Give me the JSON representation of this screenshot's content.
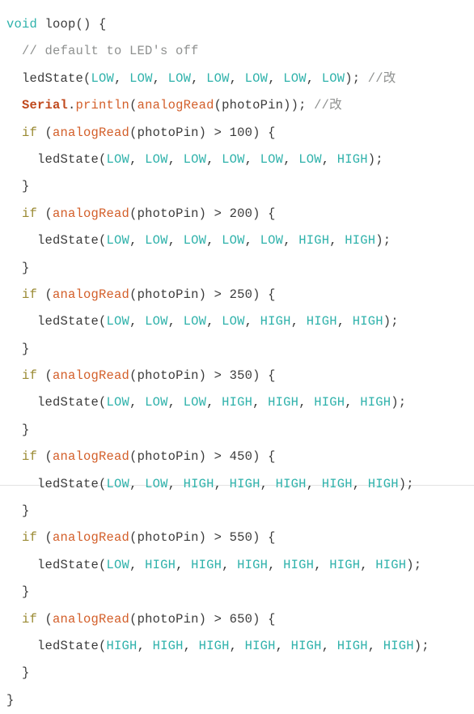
{
  "code_block": {
    "language": "arduino",
    "background_color": "#ffffff",
    "colors": {
      "keyword": "#2fb2ab",
      "constant": "#2fb2ab",
      "control": "#9a8a33",
      "function": "#d35f2a",
      "object": "#c0491d",
      "comment": "#8f9190",
      "plain": "#3b3b3b",
      "border": "#e3e3e3"
    },
    "lines": [
      {
        "indent": 0,
        "tokens": [
          {
            "text": "void",
            "type": "keyword"
          },
          {
            "text": " ",
            "type": "plain"
          },
          {
            "text": "loop",
            "type": "plain"
          },
          {
            "text": "() {",
            "type": "punct"
          }
        ]
      },
      {
        "indent": 1,
        "tokens": [
          {
            "text": "// default to LED's off",
            "type": "comment"
          }
        ]
      },
      {
        "indent": 1,
        "tokens": [
          {
            "text": "ledState",
            "type": "plain"
          },
          {
            "text": "(",
            "type": "punct"
          },
          {
            "text": "LOW",
            "type": "constant"
          },
          {
            "text": ", ",
            "type": "punct"
          },
          {
            "text": "LOW",
            "type": "constant"
          },
          {
            "text": ", ",
            "type": "punct"
          },
          {
            "text": "LOW",
            "type": "constant"
          },
          {
            "text": ", ",
            "type": "punct"
          },
          {
            "text": "LOW",
            "type": "constant"
          },
          {
            "text": ", ",
            "type": "punct"
          },
          {
            "text": "LOW",
            "type": "constant"
          },
          {
            "text": ", ",
            "type": "punct"
          },
          {
            "text": "LOW",
            "type": "constant"
          },
          {
            "text": ", ",
            "type": "punct"
          },
          {
            "text": "LOW",
            "type": "constant"
          },
          {
            "text": "); ",
            "type": "punct"
          },
          {
            "text": "//改",
            "type": "comment"
          }
        ]
      },
      {
        "indent": 1,
        "tokens": [
          {
            "text": "Serial",
            "type": "object"
          },
          {
            "text": ".",
            "type": "punct"
          },
          {
            "text": "println",
            "type": "function"
          },
          {
            "text": "(",
            "type": "punct"
          },
          {
            "text": "analogRead",
            "type": "function"
          },
          {
            "text": "(photoPin)); ",
            "type": "punct"
          },
          {
            "text": "//改",
            "type": "comment"
          }
        ]
      },
      {
        "indent": 1,
        "tokens": [
          {
            "text": "if",
            "type": "control"
          },
          {
            "text": " (",
            "type": "punct"
          },
          {
            "text": "analogRead",
            "type": "function"
          },
          {
            "text": "(photoPin) > ",
            "type": "punct"
          },
          {
            "text": "100",
            "type": "number"
          },
          {
            "text": ") {",
            "type": "punct"
          }
        ]
      },
      {
        "indent": 2,
        "tokens": [
          {
            "text": "ledState",
            "type": "plain"
          },
          {
            "text": "(",
            "type": "punct"
          },
          {
            "text": "LOW",
            "type": "constant"
          },
          {
            "text": ", ",
            "type": "punct"
          },
          {
            "text": "LOW",
            "type": "constant"
          },
          {
            "text": ", ",
            "type": "punct"
          },
          {
            "text": "LOW",
            "type": "constant"
          },
          {
            "text": ", ",
            "type": "punct"
          },
          {
            "text": "LOW",
            "type": "constant"
          },
          {
            "text": ", ",
            "type": "punct"
          },
          {
            "text": "LOW",
            "type": "constant"
          },
          {
            "text": ", ",
            "type": "punct"
          },
          {
            "text": "LOW",
            "type": "constant"
          },
          {
            "text": ", ",
            "type": "punct"
          },
          {
            "text": "HIGH",
            "type": "constant"
          },
          {
            "text": ");",
            "type": "punct"
          }
        ]
      },
      {
        "indent": 1,
        "tokens": [
          {
            "text": "}",
            "type": "punct"
          }
        ]
      },
      {
        "indent": 1,
        "tokens": [
          {
            "text": "if",
            "type": "control"
          },
          {
            "text": " (",
            "type": "punct"
          },
          {
            "text": "analogRead",
            "type": "function"
          },
          {
            "text": "(photoPin) > ",
            "type": "punct"
          },
          {
            "text": "200",
            "type": "number"
          },
          {
            "text": ") {",
            "type": "punct"
          }
        ]
      },
      {
        "indent": 2,
        "tokens": [
          {
            "text": "ledState",
            "type": "plain"
          },
          {
            "text": "(",
            "type": "punct"
          },
          {
            "text": "LOW",
            "type": "constant"
          },
          {
            "text": ", ",
            "type": "punct"
          },
          {
            "text": "LOW",
            "type": "constant"
          },
          {
            "text": ", ",
            "type": "punct"
          },
          {
            "text": "LOW",
            "type": "constant"
          },
          {
            "text": ", ",
            "type": "punct"
          },
          {
            "text": "LOW",
            "type": "constant"
          },
          {
            "text": ", ",
            "type": "punct"
          },
          {
            "text": "LOW",
            "type": "constant"
          },
          {
            "text": ", ",
            "type": "punct"
          },
          {
            "text": "HIGH",
            "type": "constant"
          },
          {
            "text": ", ",
            "type": "punct"
          },
          {
            "text": "HIGH",
            "type": "constant"
          },
          {
            "text": ");",
            "type": "punct"
          }
        ]
      },
      {
        "indent": 1,
        "tokens": [
          {
            "text": "}",
            "type": "punct"
          }
        ]
      },
      {
        "indent": 1,
        "tokens": [
          {
            "text": "if",
            "type": "control"
          },
          {
            "text": " (",
            "type": "punct"
          },
          {
            "text": "analogRead",
            "type": "function"
          },
          {
            "text": "(photoPin) > ",
            "type": "punct"
          },
          {
            "text": "250",
            "type": "number"
          },
          {
            "text": ") {",
            "type": "punct"
          }
        ]
      },
      {
        "indent": 2,
        "tokens": [
          {
            "text": "ledState",
            "type": "plain"
          },
          {
            "text": "(",
            "type": "punct"
          },
          {
            "text": "LOW",
            "type": "constant"
          },
          {
            "text": ", ",
            "type": "punct"
          },
          {
            "text": "LOW",
            "type": "constant"
          },
          {
            "text": ", ",
            "type": "punct"
          },
          {
            "text": "LOW",
            "type": "constant"
          },
          {
            "text": ", ",
            "type": "punct"
          },
          {
            "text": "LOW",
            "type": "constant"
          },
          {
            "text": ", ",
            "type": "punct"
          },
          {
            "text": "HIGH",
            "type": "constant"
          },
          {
            "text": ", ",
            "type": "punct"
          },
          {
            "text": "HIGH",
            "type": "constant"
          },
          {
            "text": ", ",
            "type": "punct"
          },
          {
            "text": "HIGH",
            "type": "constant"
          },
          {
            "text": ");",
            "type": "punct"
          }
        ]
      },
      {
        "indent": 1,
        "tokens": [
          {
            "text": "}",
            "type": "punct"
          }
        ]
      },
      {
        "indent": 1,
        "tokens": [
          {
            "text": "if",
            "type": "control"
          },
          {
            "text": " (",
            "type": "punct"
          },
          {
            "text": "analogRead",
            "type": "function"
          },
          {
            "text": "(photoPin) > ",
            "type": "punct"
          },
          {
            "text": "350",
            "type": "number"
          },
          {
            "text": ") {",
            "type": "punct"
          }
        ]
      },
      {
        "indent": 2,
        "tokens": [
          {
            "text": "ledState",
            "type": "plain"
          },
          {
            "text": "(",
            "type": "punct"
          },
          {
            "text": "LOW",
            "type": "constant"
          },
          {
            "text": ", ",
            "type": "punct"
          },
          {
            "text": "LOW",
            "type": "constant"
          },
          {
            "text": ", ",
            "type": "punct"
          },
          {
            "text": "LOW",
            "type": "constant"
          },
          {
            "text": ", ",
            "type": "punct"
          },
          {
            "text": "HIGH",
            "type": "constant"
          },
          {
            "text": ", ",
            "type": "punct"
          },
          {
            "text": "HIGH",
            "type": "constant"
          },
          {
            "text": ", ",
            "type": "punct"
          },
          {
            "text": "HIGH",
            "type": "constant"
          },
          {
            "text": ", ",
            "type": "punct"
          },
          {
            "text": "HIGH",
            "type": "constant"
          },
          {
            "text": ");",
            "type": "punct"
          }
        ]
      },
      {
        "indent": 1,
        "tokens": [
          {
            "text": "}",
            "type": "punct"
          }
        ]
      },
      {
        "indent": 1,
        "tokens": [
          {
            "text": "if",
            "type": "control"
          },
          {
            "text": " (",
            "type": "punct"
          },
          {
            "text": "analogRead",
            "type": "function"
          },
          {
            "text": "(photoPin) > ",
            "type": "punct"
          },
          {
            "text": "450",
            "type": "number"
          },
          {
            "text": ") {",
            "type": "punct"
          }
        ]
      },
      {
        "indent": 2,
        "tokens": [
          {
            "text": "ledState",
            "type": "plain"
          },
          {
            "text": "(",
            "type": "punct"
          },
          {
            "text": "LOW",
            "type": "constant"
          },
          {
            "text": ", ",
            "type": "punct"
          },
          {
            "text": "LOW",
            "type": "constant"
          },
          {
            "text": ", ",
            "type": "punct"
          },
          {
            "text": "HIGH",
            "type": "constant"
          },
          {
            "text": ", ",
            "type": "punct"
          },
          {
            "text": "HIGH",
            "type": "constant"
          },
          {
            "text": ", ",
            "type": "punct"
          },
          {
            "text": "HIGH",
            "type": "constant"
          },
          {
            "text": ", ",
            "type": "punct"
          },
          {
            "text": "HIGH",
            "type": "constant"
          },
          {
            "text": ", ",
            "type": "punct"
          },
          {
            "text": "HIGH",
            "type": "constant"
          },
          {
            "text": ");",
            "type": "punct"
          }
        ]
      },
      {
        "indent": 1,
        "tokens": [
          {
            "text": "}",
            "type": "punct"
          }
        ]
      },
      {
        "indent": 1,
        "tokens": [
          {
            "text": "if",
            "type": "control"
          },
          {
            "text": " (",
            "type": "punct"
          },
          {
            "text": "analogRead",
            "type": "function"
          },
          {
            "text": "(photoPin) > ",
            "type": "punct"
          },
          {
            "text": "550",
            "type": "number"
          },
          {
            "text": ") {",
            "type": "punct"
          }
        ]
      },
      {
        "indent": 2,
        "tokens": [
          {
            "text": "ledState",
            "type": "plain"
          },
          {
            "text": "(",
            "type": "punct"
          },
          {
            "text": "LOW",
            "type": "constant"
          },
          {
            "text": ", ",
            "type": "punct"
          },
          {
            "text": "HIGH",
            "type": "constant"
          },
          {
            "text": ", ",
            "type": "punct"
          },
          {
            "text": "HIGH",
            "type": "constant"
          },
          {
            "text": ", ",
            "type": "punct"
          },
          {
            "text": "HIGH",
            "type": "constant"
          },
          {
            "text": ", ",
            "type": "punct"
          },
          {
            "text": "HIGH",
            "type": "constant"
          },
          {
            "text": ", ",
            "type": "punct"
          },
          {
            "text": "HIGH",
            "type": "constant"
          },
          {
            "text": ", ",
            "type": "punct"
          },
          {
            "text": "HIGH",
            "type": "constant"
          },
          {
            "text": ");",
            "type": "punct"
          }
        ]
      },
      {
        "indent": 1,
        "tokens": [
          {
            "text": "}",
            "type": "punct"
          }
        ]
      },
      {
        "indent": 1,
        "tokens": [
          {
            "text": "if",
            "type": "control"
          },
          {
            "text": " (",
            "type": "punct"
          },
          {
            "text": "analogRead",
            "type": "function"
          },
          {
            "text": "(photoPin) > ",
            "type": "punct"
          },
          {
            "text": "650",
            "type": "number"
          },
          {
            "text": ") {",
            "type": "punct"
          }
        ]
      },
      {
        "indent": 2,
        "tokens": [
          {
            "text": "ledState",
            "type": "plain"
          },
          {
            "text": "(",
            "type": "punct"
          },
          {
            "text": "HIGH",
            "type": "constant"
          },
          {
            "text": ", ",
            "type": "punct"
          },
          {
            "text": "HIGH",
            "type": "constant"
          },
          {
            "text": ", ",
            "type": "punct"
          },
          {
            "text": "HIGH",
            "type": "constant"
          },
          {
            "text": ", ",
            "type": "punct"
          },
          {
            "text": "HIGH",
            "type": "constant"
          },
          {
            "text": ", ",
            "type": "punct"
          },
          {
            "text": "HIGH",
            "type": "constant"
          },
          {
            "text": ", ",
            "type": "punct"
          },
          {
            "text": "HIGH",
            "type": "constant"
          },
          {
            "text": ", ",
            "type": "punct"
          },
          {
            "text": "HIGH",
            "type": "constant"
          },
          {
            "text": ");",
            "type": "punct"
          }
        ]
      },
      {
        "indent": 1,
        "tokens": [
          {
            "text": "}",
            "type": "punct"
          }
        ]
      },
      {
        "indent": 0,
        "tokens": [
          {
            "text": "}",
            "type": "punct"
          }
        ]
      }
    ]
  }
}
